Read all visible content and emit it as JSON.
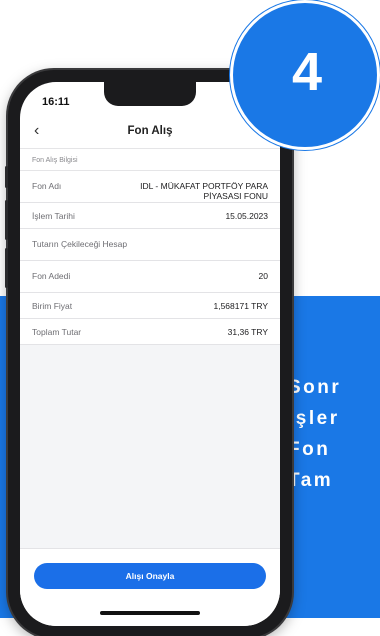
{
  "badge": {
    "step": "4"
  },
  "promo": {
    "lines": [
      "Sonr",
      "İşler",
      "Fon ",
      "Tam"
    ]
  },
  "status_bar": {
    "time": "16:11",
    "signal": "••"
  },
  "nav": {
    "title": "Fon Alış"
  },
  "section": {
    "label": "Fon Alış Bilgisi"
  },
  "rows": [
    {
      "label": "Fon Adı",
      "value_line1": "IDL - MÜKAFAT PORTFÖY PARA",
      "value_line2": "PİYASASI FONU"
    },
    {
      "label": "İşlem Tarihi",
      "value": "15.05.2023"
    },
    {
      "label": "Tutarın Çekileceği Hesap",
      "value": ""
    },
    {
      "label": "Fon Adedi",
      "value": "20"
    },
    {
      "label": "Birim Fiyat",
      "value": "1,568171 TRY"
    },
    {
      "label": "Toplam Tutar",
      "value": "31,36 TRY"
    }
  ],
  "footer": {
    "confirm_label": "Alışı Onayla"
  },
  "colors": {
    "brand_blue": "#1a78e6",
    "button_blue": "#1b6fe8"
  }
}
